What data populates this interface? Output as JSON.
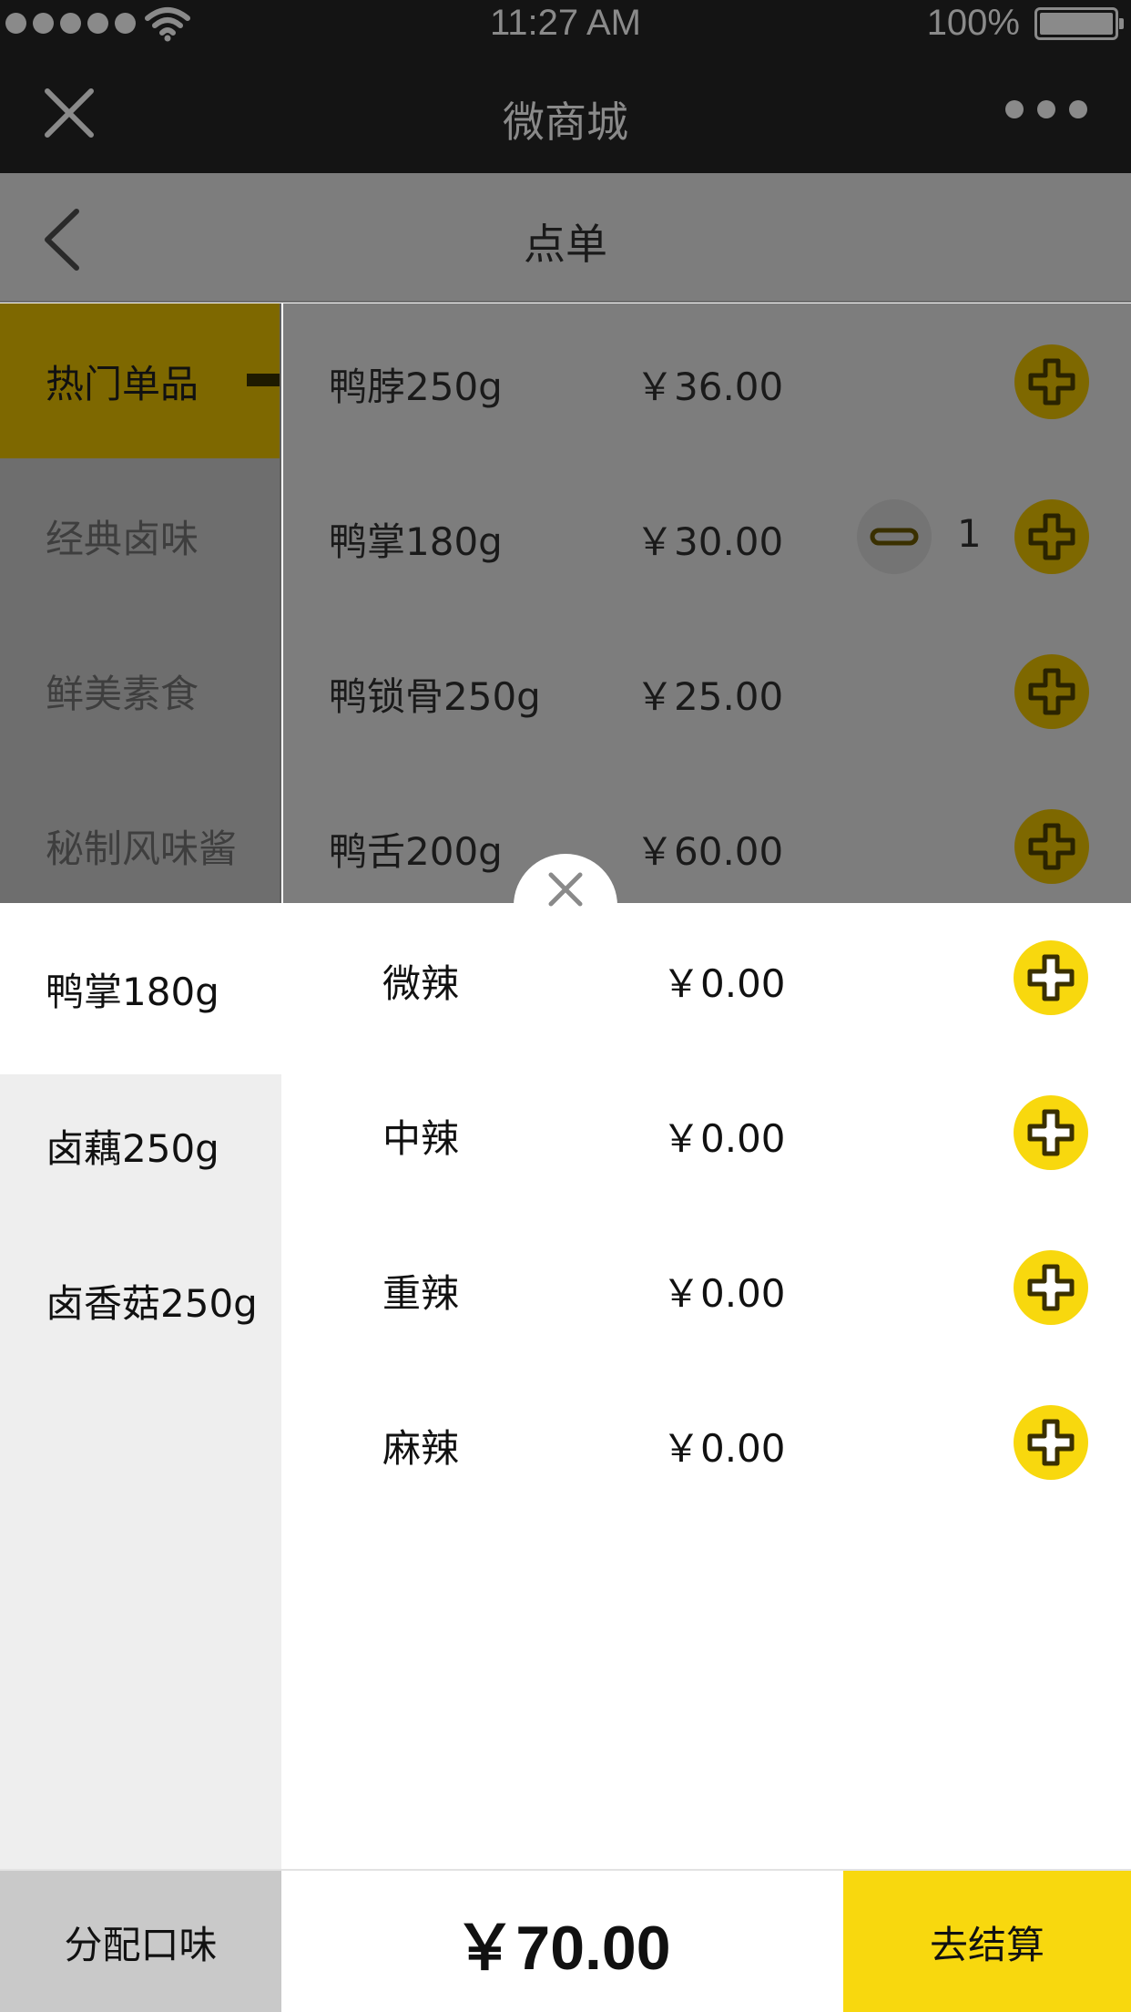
{
  "status_bar": {
    "time": "11:27 AM",
    "battery": "100%"
  },
  "wechat_bar": {
    "title": "微商城"
  },
  "header": {
    "title": "点单"
  },
  "categories": [
    {
      "label": "热门单品",
      "active": true
    },
    {
      "label": "经典卤味"
    },
    {
      "label": "鲜美素食"
    },
    {
      "label": "秘制风味酱"
    }
  ],
  "products": [
    {
      "name": "鸭脖250g",
      "price": "￥36.00"
    },
    {
      "name": "鸭掌180g",
      "price": "￥30.00",
      "qty": "1"
    },
    {
      "name": "鸭锁骨250g",
      "price": "￥25.00"
    },
    {
      "name": "鸭舌200g",
      "price": "￥60.00"
    }
  ],
  "flavor_sheet": {
    "items": [
      {
        "label": "鸭掌180g",
        "active": true
      },
      {
        "label": "卤藕250g"
      },
      {
        "label": "卤香菇250g"
      }
    ],
    "options": [
      {
        "name": "微辣",
        "price": "￥0.00"
      },
      {
        "name": "中辣",
        "price": "￥0.00"
      },
      {
        "name": "重辣",
        "price": "￥0.00"
      },
      {
        "name": "麻辣",
        "price": "￥0.00"
      }
    ]
  },
  "footer": {
    "assign_label": "分配口味",
    "total": "￥70.00",
    "checkout_label": "去结算"
  },
  "colors": {
    "accent": "#f8d80e",
    "dark_bar": "#141414",
    "overlay_gray": "#7d7d7d"
  }
}
